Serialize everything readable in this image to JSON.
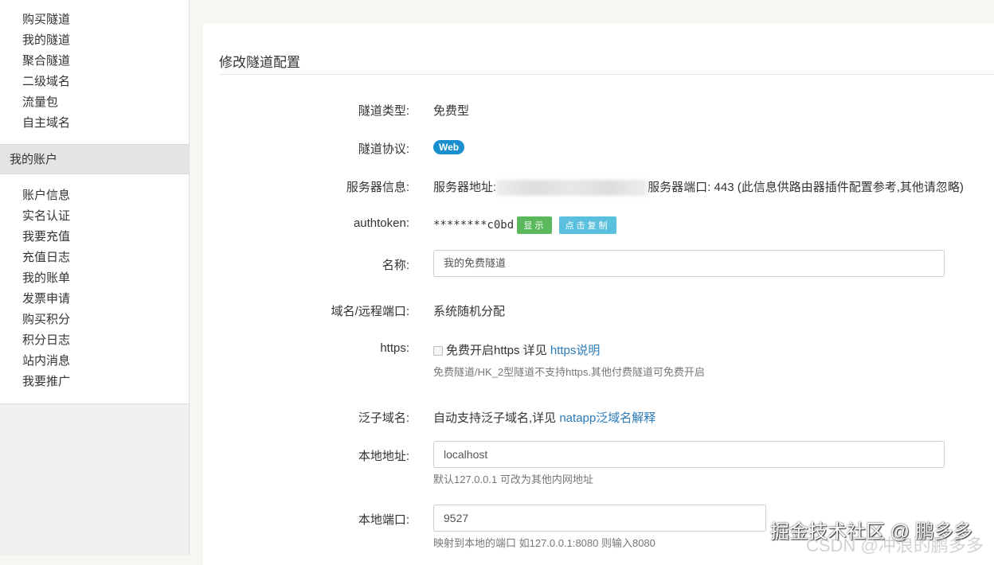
{
  "sidebar": {
    "top_items": [
      "购买隧道",
      "我的隧道",
      "聚合隧道",
      "二级域名",
      "流量包",
      "自主域名"
    ],
    "account_header": "我的账户",
    "account_items": [
      "账户信息",
      "实名认证",
      "我要充值",
      "充值日志",
      "我的账单",
      "发票申请",
      "购买积分",
      "积分日志",
      "站内消息",
      "我要推广"
    ]
  },
  "main": {
    "title": "修改隧道配置",
    "type": {
      "label": "隧道类型:",
      "value": "免费型"
    },
    "protocol": {
      "label": "隧道协议:",
      "value": "Web"
    },
    "server": {
      "label": "服务器信息:",
      "addr_label": "服务器地址:",
      "port_text": "服务器端口: 443 (此信息供路由器插件配置参考,其他请忽略)"
    },
    "authtoken": {
      "label": "authtoken:",
      "value": "********c0bd",
      "show": "显示",
      "copy": "点击复制"
    },
    "name": {
      "label": "名称:",
      "value": "我的免费隧道"
    },
    "domain": {
      "label": "域名/远程端口:",
      "value": "系统随机分配"
    },
    "https": {
      "label": "https:",
      "checkbox_text": "免费开启https 详见 ",
      "link": "https说明",
      "help": "免费隧道/HK_2型隧道不支持https.其他付费隧道可免费开启"
    },
    "wildcard": {
      "label": "泛子域名:",
      "text": "自动支持泛子域名,详见 ",
      "link": "natapp泛域名解释"
    },
    "local_addr": {
      "label": "本地地址:",
      "value": "localhost",
      "help": "默认127.0.0.1 可改为其他内网地址"
    },
    "local_port": {
      "label": "本地端口:",
      "value": "9527",
      "help": "映射到本地的端口 如127.0.0.1:8080 则输入8080"
    }
  },
  "watermarks": [
    "掘金技术社区 @ 鹏多多",
    "CSDN @冲浪的鹏多多"
  ]
}
